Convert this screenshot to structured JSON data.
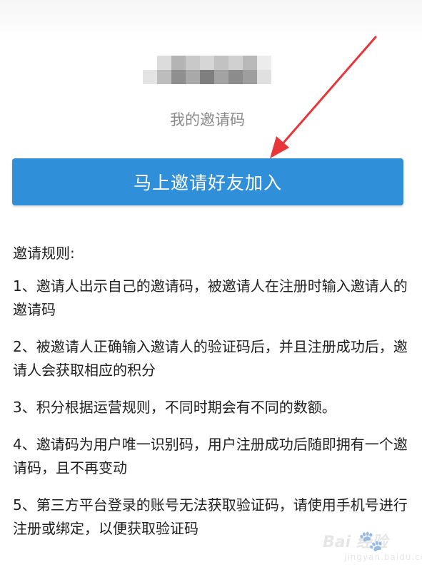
{
  "invite": {
    "code_label": "我的邀请码",
    "button_label": "马上邀请好友加入"
  },
  "rules": {
    "title": "邀请规则:",
    "items": [
      "1、邀请人出示自己的邀请码，被邀请人在注册时输入邀请人的邀请码",
      "2、被邀请人正确输入邀请人的验证码后，并且注册成功后，邀请人会获取相应的积分",
      "3、积分根据运营规则，不同时期会有不同的数额。",
      "4、邀请码为用户唯一识别码，用户注册成功后随即拥有一个邀请码，且不再变动",
      "5、第三方平台登录的账号无法获取验证码，请使用手机号进行注册或绑定，以便获取验证码"
    ]
  },
  "colors": {
    "button": "#2f8fd9",
    "arrow": "#e8353a",
    "label_gray": "#8a8a8a"
  },
  "watermark": {
    "main": "Bai  经验",
    "sub": "jingyan.baidu.com",
    "icon": "baidu-paw-icon"
  }
}
